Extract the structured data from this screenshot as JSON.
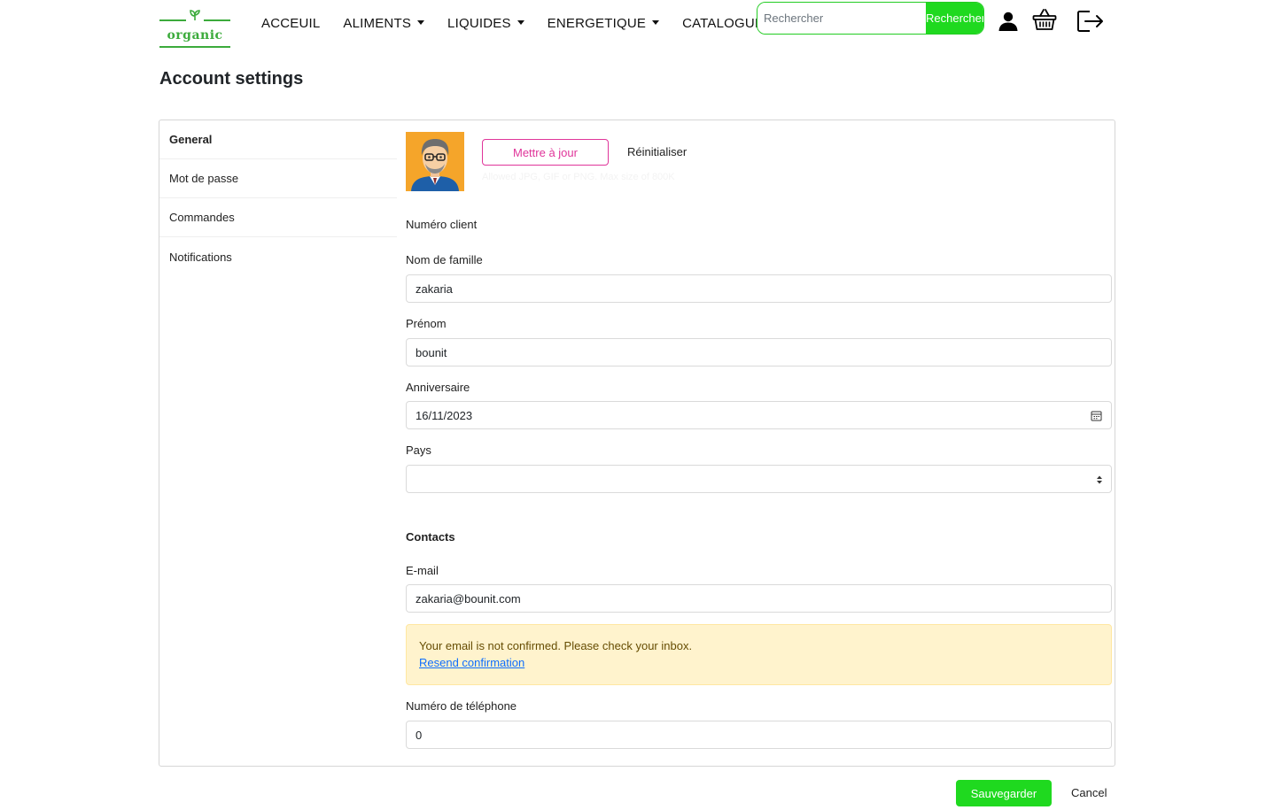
{
  "brand": {
    "name": "organic",
    "color": "#3cab3c"
  },
  "nav": {
    "items": [
      {
        "label": "ACCEUIL",
        "dropdown": false
      },
      {
        "label": "ALIMENTS",
        "dropdown": true
      },
      {
        "label": "LIQUIDES",
        "dropdown": true
      },
      {
        "label": "ENERGETIQUE",
        "dropdown": true
      },
      {
        "label": "CATALOGUE",
        "dropdown": false
      }
    ],
    "search": {
      "placeholder": "Rechercher",
      "value": "",
      "button_label": "Rechercher"
    },
    "icons": [
      "user-icon",
      "basket-icon",
      "logout-icon"
    ]
  },
  "page": {
    "title": "Account settings"
  },
  "sidebar": {
    "items": [
      {
        "label": "General",
        "active": true
      },
      {
        "label": "Mot de passe",
        "active": false
      },
      {
        "label": "Commandes",
        "active": false
      },
      {
        "label": "Notifications",
        "active": false
      }
    ]
  },
  "profile": {
    "avatar_icon": "avatar-cartoon-man",
    "update_label": "Mettre à jour",
    "reset_label": "Réinitialiser",
    "hint": "Allowed JPG, GIF or PNG. Max size of 800K"
  },
  "form": {
    "client_number_label": "Numéro client",
    "last_name": {
      "label": "Nom de famille",
      "value": "zakaria"
    },
    "first_name": {
      "label": "Prénom",
      "value": "bounit"
    },
    "birthday": {
      "label": "Anniversaire",
      "value": "16/11/2023"
    },
    "country": {
      "label": "Pays",
      "value": ""
    },
    "contacts_heading": "Contacts",
    "email": {
      "label": "E-mail",
      "value": "zakaria@bounit.com"
    },
    "alert": {
      "text": "Your email is not confirmed. Please check your inbox.",
      "link": "Resend confirmation"
    },
    "phone": {
      "label": "Numéro de téléphone",
      "value": "0"
    }
  },
  "actions": {
    "save_label": "Sauvegarder",
    "cancel_label": "Cancel"
  },
  "colors": {
    "accent_green": "#1fd91f",
    "accent_pink": "#e0359a",
    "alert_bg": "#fff3cd",
    "link": "#0d6efd"
  }
}
